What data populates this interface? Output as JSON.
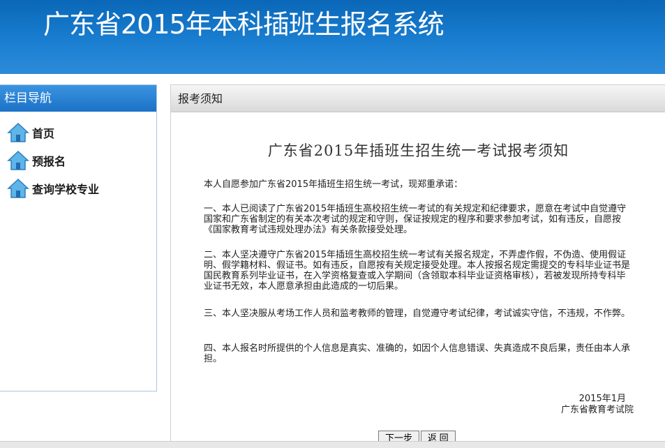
{
  "header": {
    "title": "广东省2015年本科插班生报名系统"
  },
  "sidebar": {
    "title": "栏目导航",
    "items": [
      {
        "label": "首页",
        "icon": "home-icon"
      },
      {
        "label": "预报名",
        "icon": "home-icon"
      },
      {
        "label": "查询学校专业",
        "icon": "home-icon"
      }
    ]
  },
  "main": {
    "panel_title": "报考须知",
    "notice_title": "广东省2015年插班生招生统一考试报考须知",
    "paragraphs": [
      "本人自愿参加广东省2015年插班生招生统一考试，现郑重承诺：",
      "一、本人已阅读了广东省2015年插班生高校招生统一考试的有关规定和纪律要求，愿意在考试中自觉遵守国家和广东省制定的有关本次考试的规定和守则，保证按规定的程序和要求参加考试，如有违反，自愿按《国家教育考试违规处理办法》有关条款接受处理。",
      "二、本人坚决遵守广东省2015年插班生高校招生统一考试有关报名规定，不弄虚作假，不伪造、使用假证明、假学籍材料、假证书。如有违反，自愿按有关规定接受处理。本人按报名规定需提交的专科毕业证书是国民教育系列毕业证书，在入学资格复查或入学期间（含领取本科毕业证资格审核），若被发现所持专科毕业证书无效，本人愿意承担由此造成的一切后果。",
      "三、本人坚决服从考场工作人员和监考教师的管理，自觉遵守考试纪律，考试诚实守信，不违规，不作弊。",
      "四、本人报名时所提供的个人信息是真实、准确的，如因个人信息错误、失真造成不良后果，责任由本人承担。"
    ],
    "sign_date": "2015年1月",
    "sign_org": "广东省教育考试院",
    "next_label": "下一步",
    "back_label": "返 回"
  },
  "colors": {
    "banner": "#1a7ed0",
    "nav_header": "#2a84d6"
  }
}
